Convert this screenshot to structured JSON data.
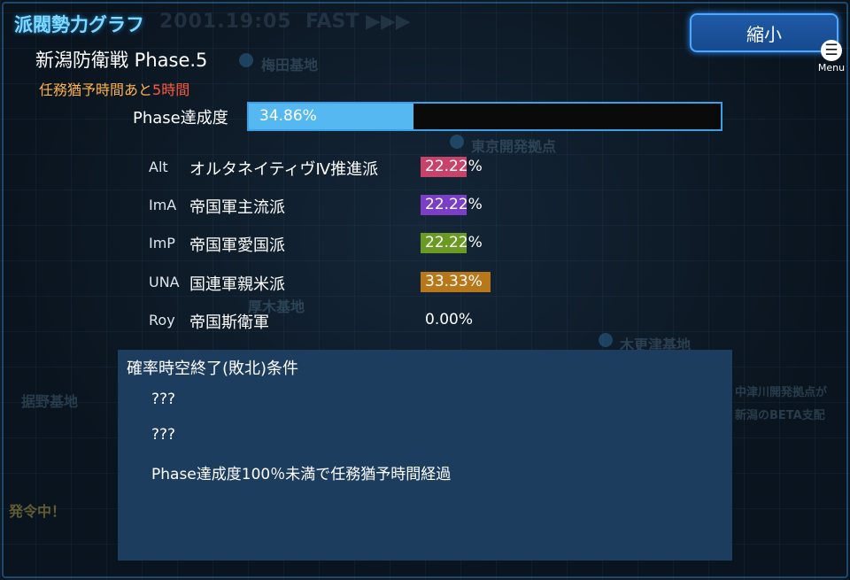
{
  "app_title": "派閥勢力グラフ",
  "header_ghost": {
    "time": "2001.19:05",
    "speed": "FAST ▶▶▶"
  },
  "shrink_button_label": "縮小",
  "menu": {
    "icon": "menu-icon",
    "label": "Menu"
  },
  "stage_title": "新潟防衛戦 Phase.5",
  "timer": {
    "prefix": "任務猶予時間あと",
    "value": "5時間"
  },
  "phase": {
    "label": "Phase達成度",
    "value_text": "34.86%",
    "fraction": 0.3486
  },
  "factions": [
    {
      "code": "Alt",
      "name": "オルタネイティヴⅣ推進派",
      "value_text": "22.22%",
      "percent": 22.22,
      "color": "#c8436a"
    },
    {
      "code": "ImA",
      "name": "帝国軍主流派",
      "value_text": "22.22%",
      "percent": 22.22,
      "color": "#7a3fc4"
    },
    {
      "code": "ImP",
      "name": "帝国軍愛国派",
      "value_text": "22.22%",
      "percent": 22.22,
      "color": "#6a9a23"
    },
    {
      "code": "UNA",
      "name": "国連軍親米派",
      "value_text": "33.33%",
      "percent": 33.33,
      "color": "#b87718"
    },
    {
      "code": "Roy",
      "name": "帝国斯衛軍",
      "value_text": "0.00%",
      "percent": 0,
      "color": "#888888"
    }
  ],
  "conditions": {
    "title": "確率時空終了(敗北)条件",
    "items": [
      "???",
      "???",
      "Phase達成度100％未満で任務猶予時間経過"
    ]
  },
  "background_labels": [
    "梅田基地",
    "東京開発拠点",
    "厚木基地",
    "木更津基地",
    "据野基地",
    "中津川開発拠点が",
    "新潟のBETA支配",
    "発令中！"
  ]
}
